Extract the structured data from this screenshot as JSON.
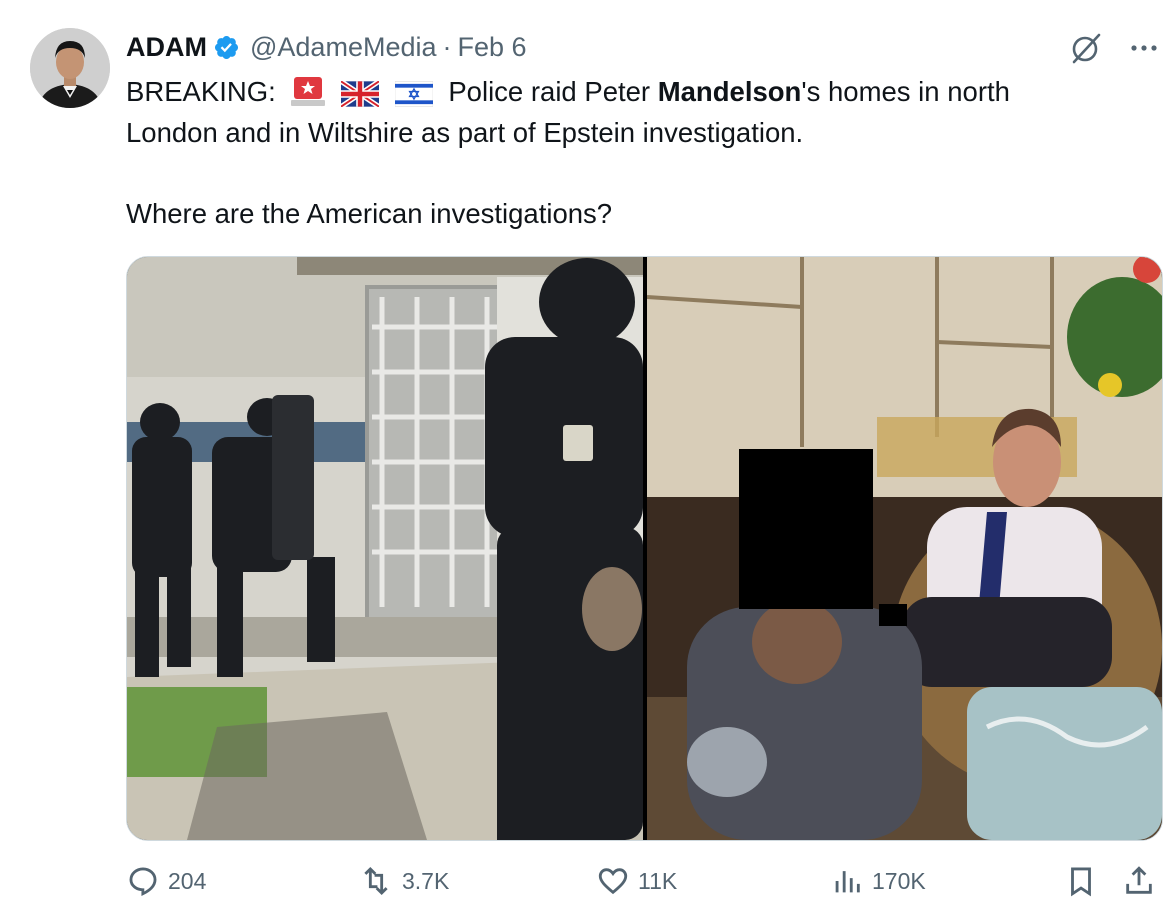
{
  "author": {
    "display_name": "ADAM",
    "handle": "@AdameMedia",
    "separator": "·",
    "date": "Feb 6"
  },
  "tweet": {
    "line1_prefix": "BREAKING:",
    "line1_emojis": [
      "police-light-emoji",
      "uk-flag-emoji",
      "israel-flag-emoji"
    ],
    "line1_before_bold": "Police raid Peter ",
    "line1_bold": "Mandelson",
    "line1_after_bold": "'s homes in north",
    "line2": "London and in Wiltshire as part of Epstein investigation.",
    "line3": "Where are the American investigations?"
  },
  "media": [
    {
      "name": "photo-police-raid",
      "description_icon": "image"
    },
    {
      "name": "photo-man-seated",
      "description_icon": "image"
    }
  ],
  "actions": {
    "replies": "204",
    "reposts": "3.7K",
    "likes": "11K",
    "views": "170K"
  },
  "colors": {
    "text": "#0f1419",
    "secondary": "#536471",
    "verified": "#1d9bf0",
    "border": "#cfd9de"
  }
}
